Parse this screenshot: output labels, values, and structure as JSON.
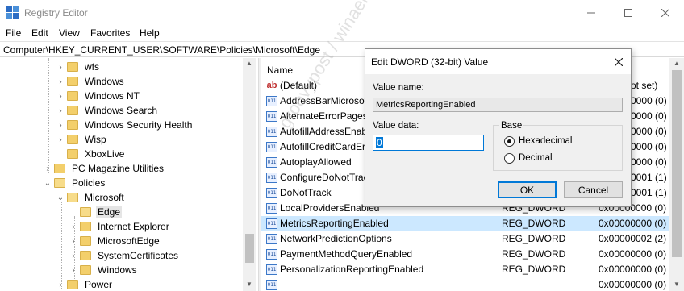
{
  "window": {
    "title": "Registry Editor",
    "controls": [
      "minimize",
      "maximize",
      "close"
    ]
  },
  "menu": [
    "File",
    "Edit",
    "View",
    "Favorites",
    "Help"
  ],
  "address": "Computer\\HKEY_CURRENT_USER\\SOFTWARE\\Policies\\Microsoft\\Edge",
  "tree": [
    {
      "label": "wfs",
      "expander": "collapsed"
    },
    {
      "label": "Windows",
      "expander": "collapsed"
    },
    {
      "label": "Windows NT",
      "expander": "collapsed"
    },
    {
      "label": "Windows Search",
      "expander": "collapsed"
    },
    {
      "label": "Windows Security Health",
      "expander": "collapsed"
    },
    {
      "label": "Wisp",
      "expander": "collapsed"
    },
    {
      "label": "XboxLive",
      "expander": "none"
    },
    {
      "label": "PC Magazine Utilities",
      "expander": "collapsed"
    },
    {
      "label": "Policies",
      "expander": "expanded"
    },
    {
      "label": "Microsoft",
      "expander": "expanded"
    },
    {
      "label": "Edge",
      "expander": "none",
      "selected": true
    },
    {
      "label": "Internet Explorer",
      "expander": "collapsed"
    },
    {
      "label": "MicrosoftEdge",
      "expander": "collapsed"
    },
    {
      "label": "SystemCertificates",
      "expander": "collapsed"
    },
    {
      "label": "Windows",
      "expander": "collapsed"
    },
    {
      "label": "Power",
      "expander": "collapsed"
    }
  ],
  "list": {
    "columns": {
      "name": "Name"
    },
    "rows": [
      {
        "name": "(Default)",
        "type": "",
        "data": "ot set)",
        "icon": "string"
      },
      {
        "name": "AddressBarMicrosof",
        "type": "",
        "data": "0000 (0)",
        "icon": "dword"
      },
      {
        "name": "AlternateErrorPages",
        "type": "",
        "data": "0000 (0)",
        "icon": "dword"
      },
      {
        "name": "AutofillAddressEnab",
        "type": "",
        "data": "0000 (0)",
        "icon": "dword"
      },
      {
        "name": "AutofillCreditCardEr",
        "type": "",
        "data": "0000 (0)",
        "icon": "dword"
      },
      {
        "name": "AutoplayAllowed",
        "type": "",
        "data": "0000 (0)",
        "icon": "dword"
      },
      {
        "name": "ConfigureDoNotTrac",
        "type": "",
        "data": "0001 (1)",
        "icon": "dword"
      },
      {
        "name": "DoNotTrack",
        "type": "",
        "data": "0001 (1)",
        "icon": "dword"
      },
      {
        "name": "LocalProvidersEnabled",
        "type": "REG_DWORD",
        "data": "0x00000000 (0)",
        "icon": "dword"
      },
      {
        "name": "MetricsReportingEnabled",
        "type": "REG_DWORD",
        "data": "0x00000000 (0)",
        "icon": "dword",
        "selected": true
      },
      {
        "name": "NetworkPredictionOptions",
        "type": "REG_DWORD",
        "data": "0x00000002 (2)",
        "icon": "dword"
      },
      {
        "name": "PaymentMethodQueryEnabled",
        "type": "REG_DWORD",
        "data": "0x00000000 (0)",
        "icon": "dword"
      },
      {
        "name": "PersonalizationReportingEnabled",
        "type": "REG_DWORD",
        "data": "0x00000000 (0)",
        "icon": "dword"
      },
      {
        "name": "",
        "type": "",
        "data": "0x00000000 (0)",
        "icon": "dword"
      }
    ]
  },
  "watermark": "groovypost / winaero",
  "dialog": {
    "title": "Edit DWORD (32-bit) Value",
    "value_name_label": "Value name:",
    "value_name": "MetricsReportingEnabled",
    "value_data_label": "Value data:",
    "value_data": "0",
    "base_label": "Base",
    "base_options": [
      {
        "label": "Hexadecimal",
        "checked": true
      },
      {
        "label": "Decimal",
        "checked": false
      }
    ],
    "ok_label": "OK",
    "cancel_label": "Cancel"
  }
}
